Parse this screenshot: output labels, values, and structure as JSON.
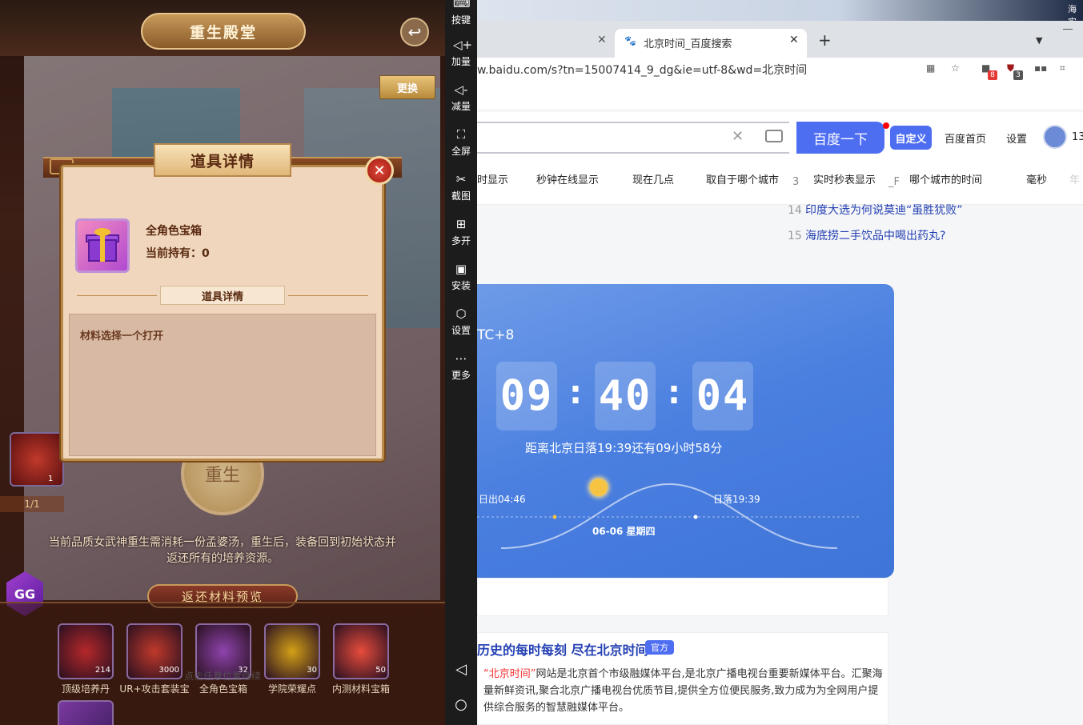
{
  "game": {
    "title": "重生殿堂",
    "swap_label": "更换",
    "rebirth_label": "重生",
    "page_indicator": "1/1",
    "left_item_count": "1",
    "description": "当前品质女武神重生需消耗一份孟婆汤，重生后，装备回到初始状态并返还所有的培养资源。",
    "return_preview": "返还材料预览",
    "gg_label": "GG",
    "faint_overlay": "点击任意位置继续",
    "slots": [
      {
        "label": "顶级培养丹",
        "count": "214",
        "color": "#b5282a"
      },
      {
        "label": "UR+攻击套装宝",
        "count": "3000",
        "color": "#c0392b"
      },
      {
        "label": "全角色宝箱",
        "count": "32",
        "color": "#8e44ad"
      },
      {
        "label": "学院荣耀点",
        "count": "30",
        "color": "#d4a017"
      },
      {
        "label": "内测材料宝箱",
        "count": "50",
        "color": "#e74c3c"
      }
    ],
    "dialog": {
      "title": "道具详情",
      "item_name": "全角色宝箱",
      "held_label": "当前持有：0",
      "section_label": "道具详情",
      "description": "材料选择一个打开"
    }
  },
  "emulator_sidebar": {
    "buttons": [
      {
        "label": "按键",
        "icon": "keyboard-icon"
      },
      {
        "label": "加量",
        "icon": "volume-up-icon"
      },
      {
        "label": "减量",
        "icon": "volume-down-icon"
      },
      {
        "label": "全屏",
        "icon": "fullscreen-icon"
      },
      {
        "label": "截图",
        "icon": "scissors-icon"
      },
      {
        "label": "多开",
        "icon": "multi-open-icon"
      },
      {
        "label": "安装",
        "icon": "apk-icon"
      },
      {
        "label": "设置",
        "icon": "gear-icon"
      },
      {
        "label": "更多",
        "icon": "more-icon"
      }
    ],
    "back_glyph": "◁",
    "home_glyph": "○"
  },
  "browser": {
    "corner_text": "海实",
    "active_tab_title": "北京时间_百度搜索",
    "url": "w.baidu.com/s?tn=15007414_9_dg&ie=utf-8&wd=北京时间",
    "badge_red": "8",
    "badge_gray": "3",
    "search_button": "百度一下",
    "custom_label": "自定义",
    "nav_home": "百度首页",
    "nav_settings": "设置",
    "avatar_suffix": "13",
    "suggestions": [
      "时显示",
      "秒钟在线显示",
      "现在几点",
      "取自于哪个城市",
      "3",
      "实时秒表显示",
      "_F",
      "哪个城市的时间",
      "毫秒",
      "年"
    ],
    "hot": [
      {
        "num": "14",
        "text": "印度大选为何说莫迪“虽胜犹败”"
      },
      {
        "num": "15",
        "text": "海底捞二手饮品中喝出药丸?"
      }
    ],
    "timecard": {
      "timezone": "TC+8",
      "hh": "09",
      "mm": "40",
      "ss": "04",
      "sunset_line": "距离北京日落19:39还有09小时58分",
      "sunrise": "日出04:46",
      "sunset": "日落19:39",
      "date_week": "06-06   星期四"
    },
    "result": {
      "title": "历史的每时每刻 尽在北京时间",
      "badge": "官方",
      "snippet_red": "“北京时间”",
      "snippet_rest": "网站是北京首个市级融媒体平台,是北京广播电视台重要新媒体平台。汇聚海量新鲜资讯,聚合北京广播电视台优质节目,提供全方位便民服务,致力成为为全网用户提供综合服务的智慧融媒体平台。"
    }
  }
}
